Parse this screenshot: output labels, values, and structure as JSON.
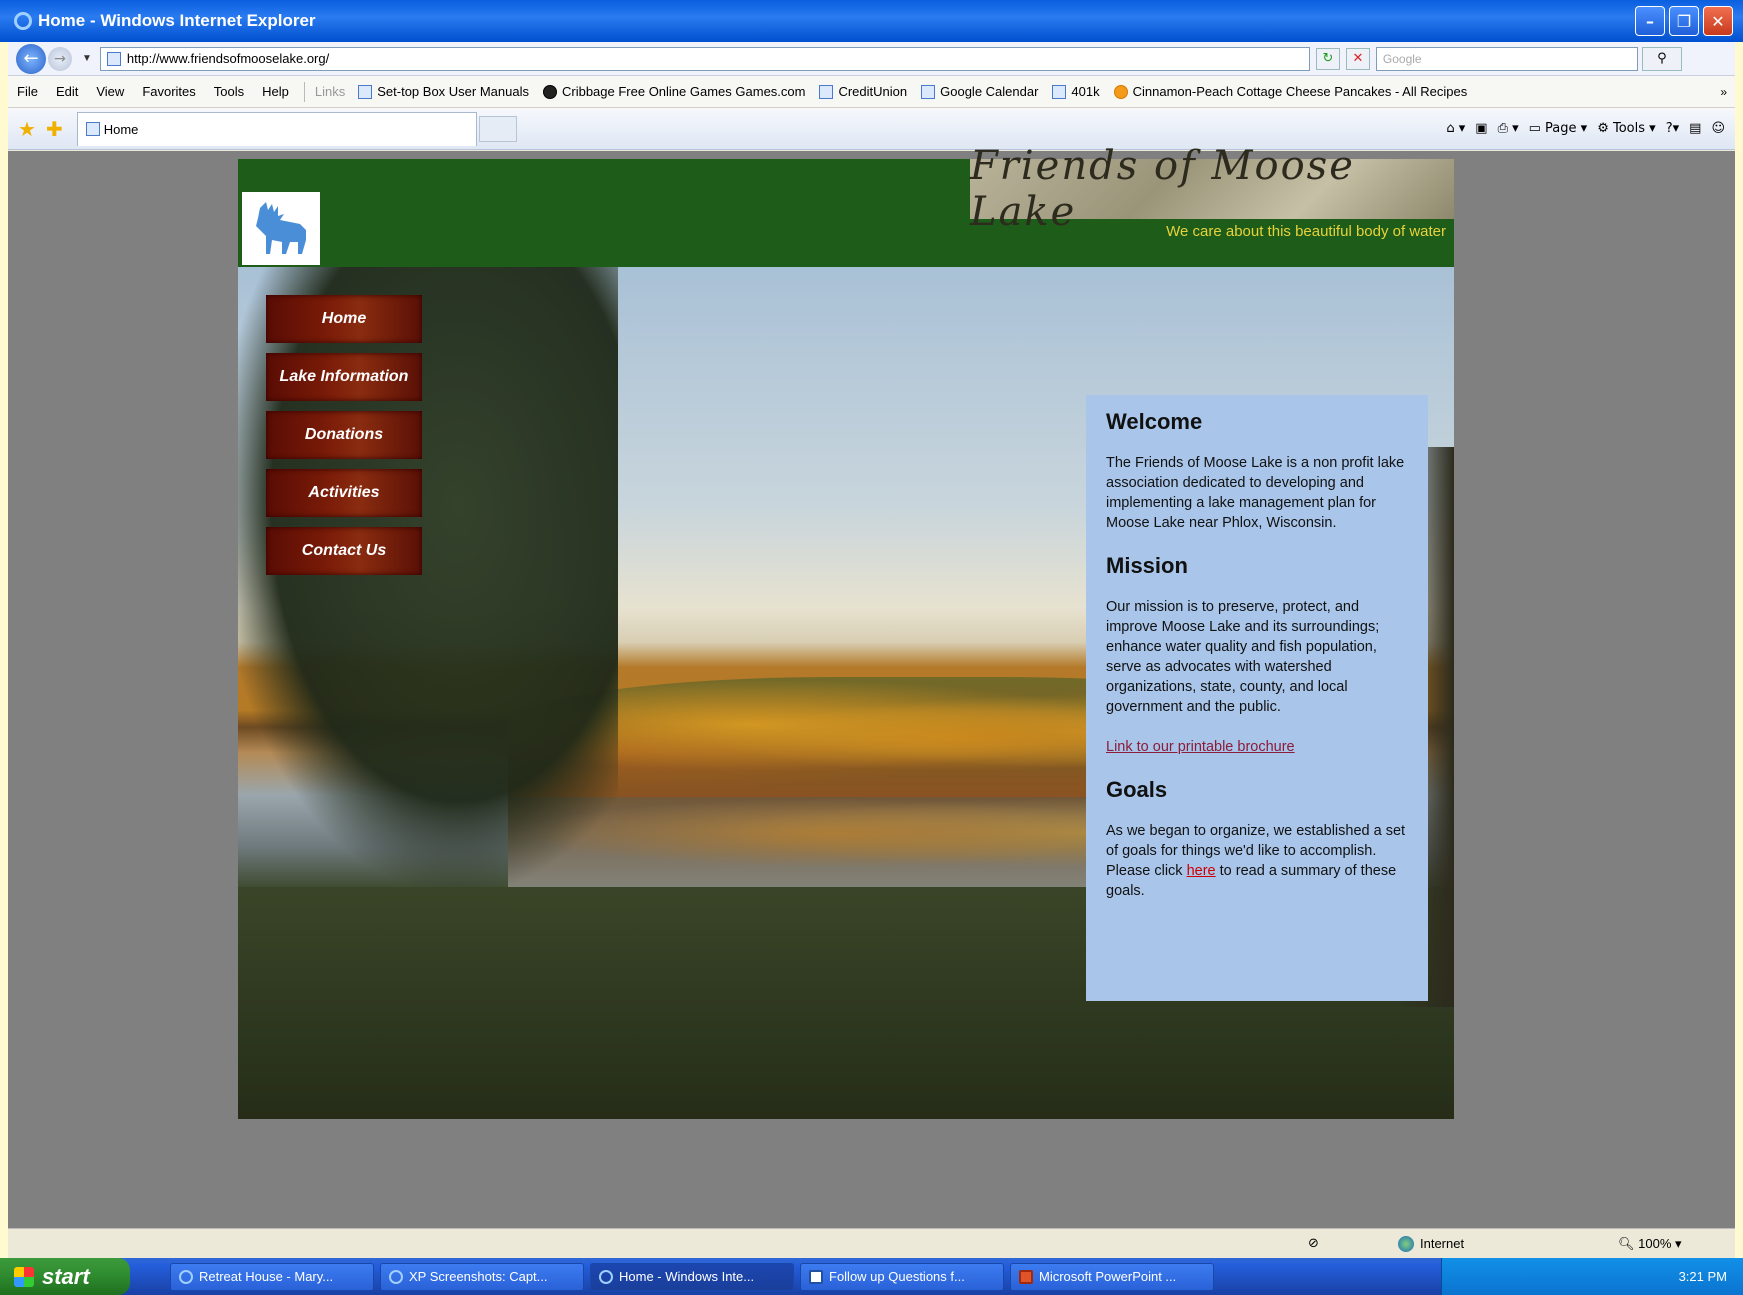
{
  "window": {
    "title": "Home - Windows Internet Explorer"
  },
  "address_bar": {
    "url": "http://www.friendsofmooselake.org/",
    "search_placeholder": "Google"
  },
  "menu_bar": [
    "File",
    "Edit",
    "View",
    "Favorites",
    "Tools",
    "Help"
  ],
  "links_label": "Links",
  "links": [
    {
      "label": "Set-top Box User Manuals",
      "icon": "ie-page-icon"
    },
    {
      "label": "Cribbage  Free Online Games  Games.com",
      "icon": "cribbage-icon"
    },
    {
      "label": "CreditUnion",
      "icon": "ie-page-icon"
    },
    {
      "label": "Google Calendar",
      "icon": "ie-page-icon"
    },
    {
      "label": "401k",
      "icon": "ie-page-icon"
    },
    {
      "label": "Cinnamon-Peach Cottage Cheese Pancakes - All Recipes",
      "icon": "allrecipes-icon"
    }
  ],
  "tab": {
    "label": "Home"
  },
  "command_bar": {
    "page": "Page",
    "tools": "Tools"
  },
  "site": {
    "title": "Friends of Moose Lake",
    "tagline": "We care about this beautiful body of water",
    "nav": [
      "Home",
      "Lake Information",
      "Donations",
      "Activities",
      "Contact Us"
    ],
    "welcome": {
      "heading": "Welcome",
      "text": "The Friends of Moose Lake is a non profit lake association dedicated to developing and implementing a lake management plan for Moose Lake near Phlox, Wisconsin."
    },
    "mission": {
      "heading": "Mission",
      "text": "Our mission is to preserve, protect, and improve Moose Lake and its surroundings; enhance water quality and fish population, serve as advocates with watershed organizations, state, county, and local government and the public.",
      "link": "Link to our printable brochure"
    },
    "goals": {
      "heading": "Goals",
      "text_before": "As we began to organize, we established a set of goals for things we'd like to accomplish.  Please click ",
      "link": "here",
      "text_after": " to read a summary of these goals."
    }
  },
  "status_bar": {
    "zone": "Internet",
    "zoom": "100%"
  },
  "taskbar": {
    "start": "start",
    "tasks": [
      {
        "label": "Retreat House - Mary...",
        "icon": "ie-icon",
        "active": false
      },
      {
        "label": "XP Screenshots: Capt...",
        "icon": "ie-icon",
        "active": false
      },
      {
        "label": "Home - Windows Inte...",
        "icon": "ie-icon",
        "active": true
      },
      {
        "label": "Follow up Questions f...",
        "icon": "word-icon",
        "active": false
      },
      {
        "label": "Microsoft PowerPoint ...",
        "icon": "powerpoint-icon",
        "active": false
      }
    ],
    "clock": "3:21 PM"
  }
}
